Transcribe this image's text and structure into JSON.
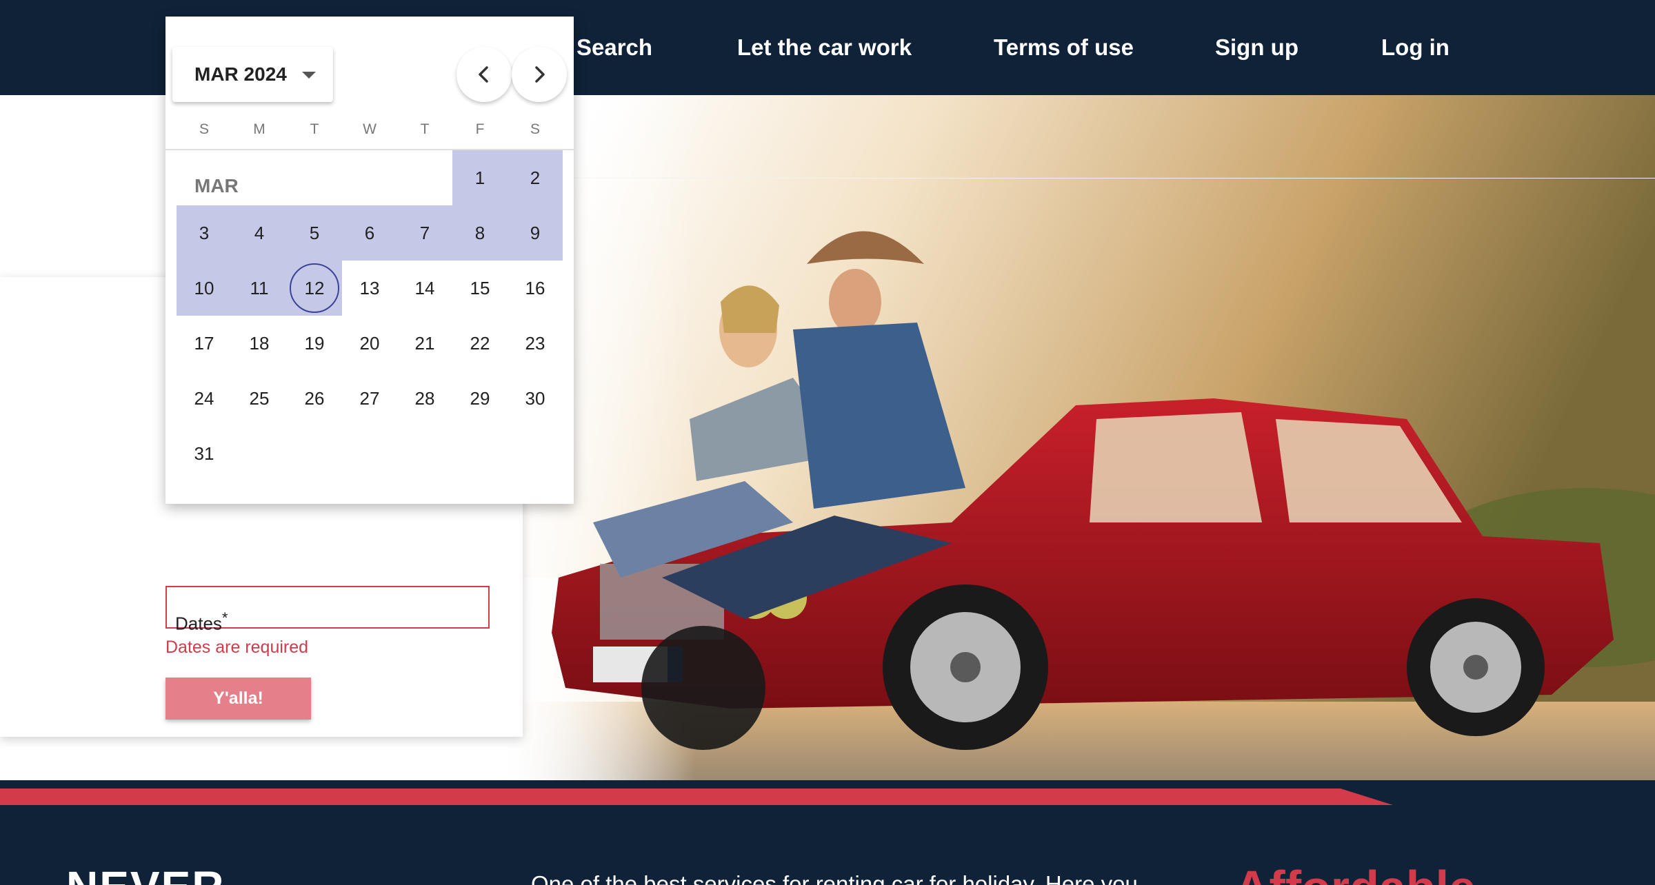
{
  "nav": {
    "links": [
      "Search",
      "Let the car work",
      "Terms of use",
      "Sign up",
      "Log in"
    ]
  },
  "form": {
    "dates_label": "Dates",
    "dates_required_mark": "*",
    "dates_error": "Dates are required",
    "submit_label": "Y'alla!"
  },
  "datepicker": {
    "period_label": "MAR 2024",
    "prev_icon": "chevron-left-icon",
    "next_icon": "chevron-right-icon",
    "weekdays": [
      "S",
      "M",
      "T",
      "W",
      "T",
      "F",
      "S"
    ],
    "month_label": "MAR",
    "first_day_column": 5,
    "days_in_month": 31,
    "selected_range": [
      1,
      12
    ],
    "today": 12
  },
  "footer": {
    "never_text": "NEVER",
    "tagline": "One of the best services for renting car for holiday. Here you",
    "headline": "Affordable"
  },
  "colors": {
    "navy": "#0f2238",
    "accent_red": "#d33a4a",
    "button_pink": "#e57f8a",
    "range_lavender": "#c5c8e6",
    "today_ring": "#3b4399"
  }
}
